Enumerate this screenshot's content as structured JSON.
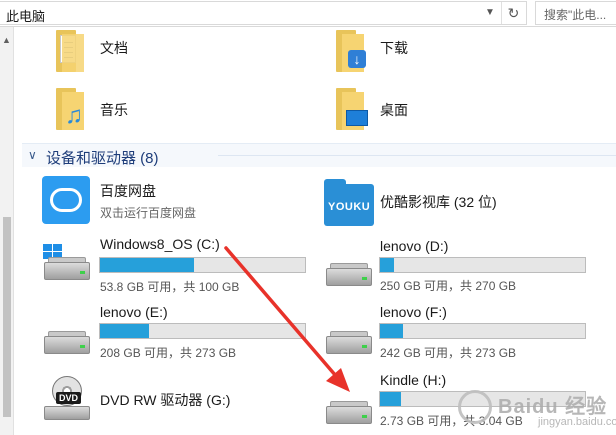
{
  "address_bar": {
    "path": "此电脑",
    "dropdown_icon": "chevron-down-icon",
    "refresh_icon": "refresh-icon"
  },
  "search": {
    "placeholder": "搜索\"此电..."
  },
  "folders": [
    {
      "label": "文档",
      "icon": "documents-folder-icon"
    },
    {
      "label": "下载",
      "icon": "downloads-folder-icon"
    },
    {
      "label": "音乐",
      "icon": "music-folder-icon"
    },
    {
      "label": "桌面",
      "icon": "desktop-folder-icon"
    }
  ],
  "group": {
    "title": "设备和驱动器 (8)",
    "chevron_icon": "chevron-down-icon"
  },
  "apps": [
    {
      "name": "百度网盘",
      "subtitle": "双击运行百度网盘",
      "icon": "baidu-netdisk-icon"
    },
    {
      "name": "优酷影视库 (32 位)",
      "icon": "youku-icon",
      "icon_text": "YOUKU"
    }
  ],
  "drives": [
    {
      "name": "Windows8_OS (C:)",
      "space": "53.8 GB 可用，共 100 GB",
      "used_fraction": 0.46
    },
    {
      "name": "lenovo (D:)",
      "space": "250 GB 可用，共 270 GB",
      "used_fraction": 0.07
    },
    {
      "name": "lenovo (E:)",
      "space": "208 GB 可用，共 273 GB",
      "used_fraction": 0.24
    },
    {
      "name": "lenovo (F:)",
      "space": "242 GB 可用，共 273 GB",
      "used_fraction": 0.11
    },
    {
      "name": "DVD RW 驱动器 (G:)",
      "icon_text": "DVD"
    },
    {
      "name": "Kindle (H:)",
      "space": "2.73 GB 可用，共 3.04 GB",
      "used_fraction": 0.1
    }
  ],
  "watermark": {
    "text": "Baidu 经验",
    "subtext": "jingyan.baidu.com"
  },
  "colors": {
    "accent": "#26a0da",
    "arrow": "#e8322a",
    "group_text": "#1e3d7a"
  }
}
